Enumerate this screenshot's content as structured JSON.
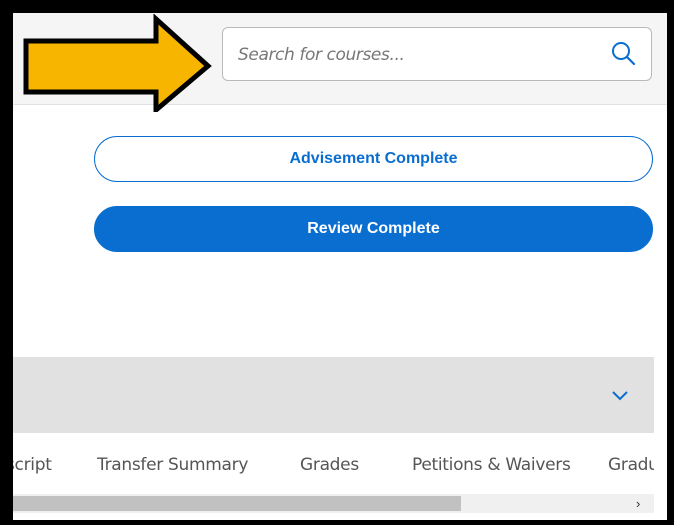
{
  "search": {
    "placeholder": "Search for courses..."
  },
  "buttons": {
    "advisement_label": "Advisement Complete",
    "review_label": "Review Complete"
  },
  "tabs": [
    {
      "label": "script"
    },
    {
      "label": "Transfer Summary"
    },
    {
      "label": "Grades"
    },
    {
      "label": "Petitions & Waivers"
    },
    {
      "label": "Gradu"
    }
  ],
  "icons": {
    "search": "search-icon",
    "expand": "chevron-down-icon",
    "scroll_right": "chevron-right-icon",
    "annotation": "arrow-right-icon"
  },
  "colors": {
    "accent": "#0a6ed1",
    "arrow_fill": "#f7b500",
    "collapse_bar": "#e1e1e1"
  }
}
